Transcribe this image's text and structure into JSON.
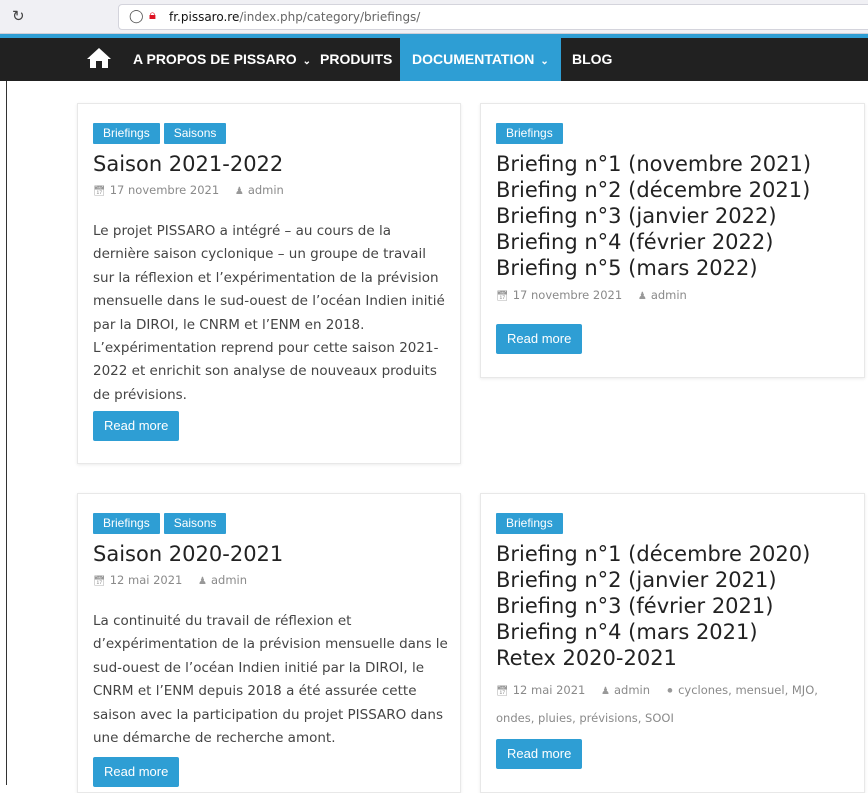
{
  "browser": {
    "url_domain": "fr.pissaro.re",
    "url_path": "/index.php/category/briefings/"
  },
  "nav": {
    "items": [
      {
        "label": "A PROPOS DE PISSARO",
        "has_dropdown": true
      },
      {
        "label": "PRODUITS",
        "has_dropdown": false
      },
      {
        "label": "DOCUMENTATION",
        "has_dropdown": true,
        "active": true
      },
      {
        "label": "BLOG",
        "has_dropdown": false
      }
    ],
    "accent_color": "#2e9ed4",
    "background_color": "#212121"
  },
  "posts": [
    {
      "tags": [
        "Briefings",
        "Saisons"
      ],
      "title_lines": [
        "Saison 2021-2022"
      ],
      "date": "17 novembre 2021",
      "author": "admin",
      "excerpt": "Le projet PISSARO a intégré – au cours de la dernière saison cyclonique – un groupe de travail sur la réflexion et l’expérimentation de la prévision mensuelle dans le sud-ouest de l’océan Indien initié par la DIROI, le CNRM et l’ENM en 2018. L’expérimentation reprend pour cette saison 2021-2022 et enrichit son analyse de nouveaux produits de prévisions.",
      "button": "Read more"
    },
    {
      "tags": [
        "Briefings"
      ],
      "title_lines": [
        "Briefing n°1 (novembre 2021)",
        "Briefing n°2 (décembre 2021)",
        "Briefing n°3 (janvier 2022)",
        "Briefing n°4 (février 2022)",
        "Briefing n°5 (mars 2022)"
      ],
      "date": "17 novembre 2021",
      "author": "admin",
      "button": "Read more"
    },
    {
      "tags": [
        "Briefings",
        "Saisons"
      ],
      "title_lines": [
        "Saison 2020-2021"
      ],
      "date": "12 mai 2021",
      "author": "admin",
      "excerpt": "La continuité du travail de réflexion et d’expérimentation de la prévision mensuelle dans le sud-ouest de l’océan Indien initié par la DIROI, le CNRM et l’ENM depuis 2018 a été assurée cette saison avec la participation du projet PISSARO dans une démarche de recherche amont.",
      "button": "Read more"
    },
    {
      "tags": [
        "Briefings"
      ],
      "title_lines": [
        "Briefing n°1 (décembre 2020)",
        "Briefing n°2 (janvier 2021)",
        "Briefing n°3 (février 2021)",
        "Briefing n°4 (mars 2021)",
        "Retex 2020-2021"
      ],
      "date": "12 mai 2021",
      "author": "admin",
      "keywords": [
        "cyclones",
        "mensuel",
        "MJO",
        "ondes",
        "pluies",
        "prévisions",
        "SOOI"
      ],
      "button": "Read more"
    }
  ]
}
